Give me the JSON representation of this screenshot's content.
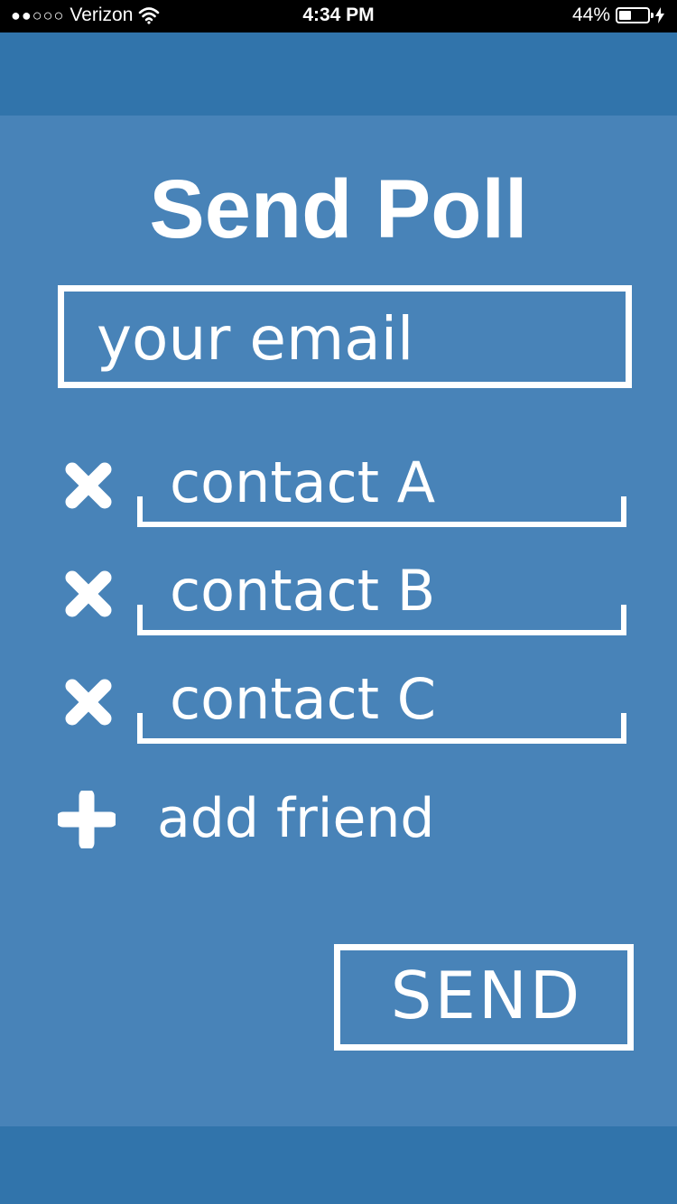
{
  "status_bar": {
    "signal": "●●○○○",
    "carrier": "Verizon",
    "wifi_icon": "wifi-icon",
    "time": "4:34 PM",
    "battery_percent": "44%",
    "battery_level": 0.44,
    "charging_icon": "bolt-icon"
  },
  "colors": {
    "panel": "#4883b8",
    "band": "#3174ab",
    "foreground": "#ffffff"
  },
  "form": {
    "title": "Send Poll",
    "email_placeholder": "your email",
    "contacts": [
      {
        "placeholder": "contact A",
        "remove_icon": "close-icon"
      },
      {
        "placeholder": "contact B",
        "remove_icon": "close-icon"
      },
      {
        "placeholder": "contact C",
        "remove_icon": "close-icon"
      }
    ],
    "add_icon": "plus-icon",
    "add_label": "add friend",
    "send_label": "SEND"
  }
}
